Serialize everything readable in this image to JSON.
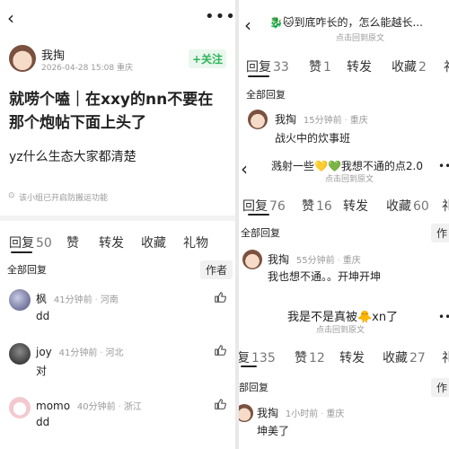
{
  "left": {
    "author_name": "我掏",
    "post_meta": "2026-04-28 15:08  重庆",
    "follow_label": "+关注",
    "title_line1": "就唠个嗑｜在xxy的nn不要在",
    "title_line2": "那个炮帖下面上头了",
    "body": "yz什么生态大家都清楚",
    "notice": "该小组已开启防搬运功能",
    "tabs": [
      {
        "label": "回复",
        "count": "50"
      },
      {
        "label": "赞",
        "count": ""
      },
      {
        "label": "转发",
        "count": ""
      },
      {
        "label": "收藏",
        "count": ""
      },
      {
        "label": "礼物",
        "count": ""
      }
    ],
    "all_replies": "全部回复",
    "author_btn": "作者",
    "comments": [
      {
        "name": "枫",
        "time": "41分钟前",
        "place": "河南",
        "text": "dd"
      },
      {
        "name": "joy",
        "time": "41分钟前",
        "place": "河北",
        "text": "对"
      },
      {
        "name": "momo",
        "time": "40分钟前",
        "place": "浙江",
        "text": "dd"
      }
    ]
  },
  "right1": {
    "title": "🐉🐱到底咋长的，怎么能越长...",
    "subtitle": "点击回到原文",
    "tabs": [
      {
        "label": "回复",
        "count": "33"
      },
      {
        "label": "赞",
        "count": "1"
      },
      {
        "label": "转发",
        "count": ""
      },
      {
        "label": "收藏",
        "count": "2"
      },
      {
        "label": "礼",
        "count": ""
      }
    ],
    "all_replies": "全部回复",
    "comment": {
      "name": "我掏",
      "time": "15分钟前",
      "place": "重庆",
      "text": "战火中的炊事班"
    }
  },
  "right2": {
    "title": "溅射一些💛💚我想不通的点2.0",
    "subtitle": "点击回到原文",
    "tabs": [
      {
        "label": "回复",
        "count": "76"
      },
      {
        "label": "赞",
        "count": "16"
      },
      {
        "label": "转发",
        "count": ""
      },
      {
        "label": "收藏",
        "count": "60"
      },
      {
        "label": "礼",
        "count": ""
      }
    ],
    "all_replies": "全部回复",
    "author_btn": "作",
    "comment": {
      "name": "我掏",
      "time": "55分钟前",
      "place": "重庆",
      "text": "我也想不通。。开坤开坤"
    }
  },
  "right3": {
    "title": "我是不是真被🐥xn了",
    "subtitle": "点击回到原文",
    "tabs": [
      {
        "label": "复",
        "count": "135"
      },
      {
        "label": "赞",
        "count": "12"
      },
      {
        "label": "转发",
        "count": ""
      },
      {
        "label": "收藏",
        "count": "27"
      },
      {
        "label": "礼",
        "count": ""
      }
    ],
    "all_replies": "部回复",
    "author_btn": "作",
    "comment": {
      "name": "我掏",
      "time": "1小时前",
      "place": "重庆",
      "text": "坤美了"
    }
  },
  "colors": {
    "accent_green": "#2fb45a",
    "text": "#222222",
    "muted": "#999999"
  }
}
